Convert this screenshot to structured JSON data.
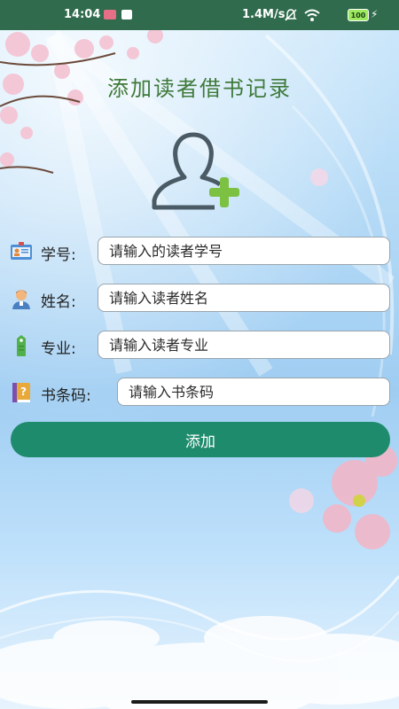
{
  "status_bar": {
    "time": "14:04",
    "network_speed": "1.4M/s",
    "battery": "100"
  },
  "page": {
    "title": "添加读者借书记录"
  },
  "form": {
    "fields": [
      {
        "label": "学号:",
        "placeholder": "请输入的读者学号",
        "icon": "student-id-card-icon"
      },
      {
        "label": "姓名:",
        "placeholder": "请输入读者姓名",
        "icon": "person-icon"
      },
      {
        "label": "专业:",
        "placeholder": "请输入读者专业",
        "icon": "green-tag-icon"
      },
      {
        "label": "书条码:",
        "placeholder": "请输入书条码",
        "icon": "book-question-icon"
      }
    ],
    "submit_label": "添加"
  },
  "colors": {
    "status_bar_bg": "#2f6b4c",
    "title": "#3f7a3a",
    "button_bg": "#1e8b6c",
    "plus_green": "#7cc142"
  }
}
